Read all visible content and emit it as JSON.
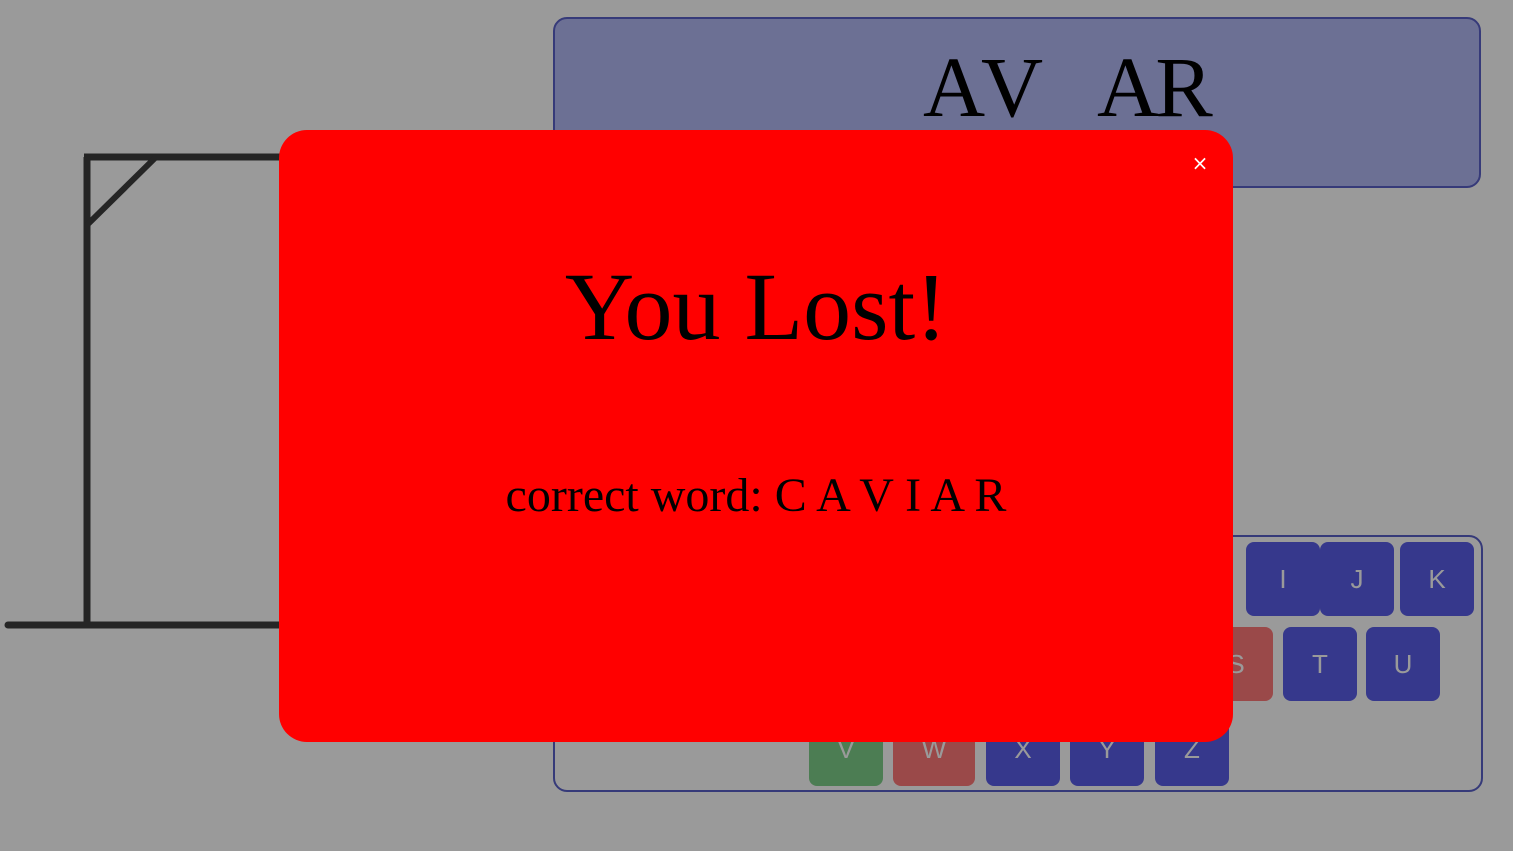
{
  "word": {
    "slots": [
      "",
      "A",
      "V",
      "",
      "A",
      "R"
    ]
  },
  "keyboard": {
    "keys": [
      {
        "label": "I",
        "state": "unused"
      },
      {
        "label": "J",
        "state": "unused"
      },
      {
        "label": "K",
        "state": "unused"
      },
      {
        "label": "S",
        "state": "wrong"
      },
      {
        "label": "T",
        "state": "unused"
      },
      {
        "label": "U",
        "state": "unused"
      },
      {
        "label": "V",
        "state": "right"
      },
      {
        "label": "W",
        "state": "wrong"
      },
      {
        "label": "X",
        "state": "unused"
      },
      {
        "label": "Y",
        "state": "unused"
      },
      {
        "label": "Z",
        "state": "unused"
      }
    ]
  },
  "modal": {
    "close_icon": "×",
    "title": "You Lost!",
    "message_prefix": "correct word:",
    "correct_word": "C A V I A R"
  },
  "colors": {
    "word_panel_bg": "#b4b9f6",
    "panel_border": "#5a61c8",
    "key_unused": "#5a5ee8",
    "key_wrong": "#ff7a7a",
    "key_right": "#7fd08a",
    "modal_bg": "#ff0000"
  }
}
